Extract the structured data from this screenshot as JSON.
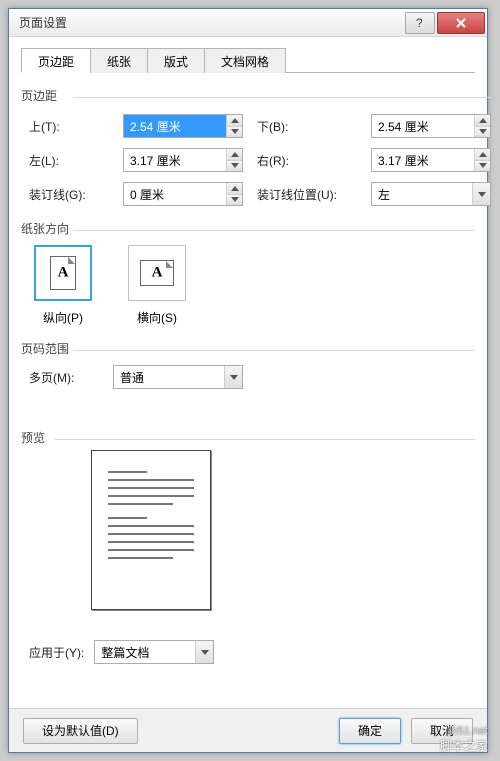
{
  "window": {
    "title": "页面设置"
  },
  "tabs": {
    "t0": "页边距",
    "t1": "纸张",
    "t2": "版式",
    "t3": "文档网格"
  },
  "margins": {
    "legend": "页边距",
    "top_label": "上(T):",
    "top_value": "2.54 厘米",
    "bottom_label": "下(B):",
    "bottom_value": "2.54 厘米",
    "left_label": "左(L):",
    "left_value": "3.17 厘米",
    "right_label": "右(R):",
    "right_value": "3.17 厘米",
    "gutter_label": "装订线(G):",
    "gutter_value": "0 厘米",
    "gutter_pos_label": "装订线位置(U):",
    "gutter_pos_value": "左"
  },
  "orientation": {
    "legend": "纸张方向",
    "portrait": "纵向(P)",
    "landscape": "横向(S)"
  },
  "pages": {
    "legend": "页码范围",
    "multi_label": "多页(M):",
    "multi_value": "普通"
  },
  "preview": {
    "legend": "预览"
  },
  "apply": {
    "label": "应用于(Y):",
    "value": "整篇文档"
  },
  "footer": {
    "default_btn": "设为默认值(D)",
    "ok": "确定",
    "cancel": "取消"
  },
  "watermark": {
    "line1": "jb51.net",
    "line2": "脚本之家"
  }
}
